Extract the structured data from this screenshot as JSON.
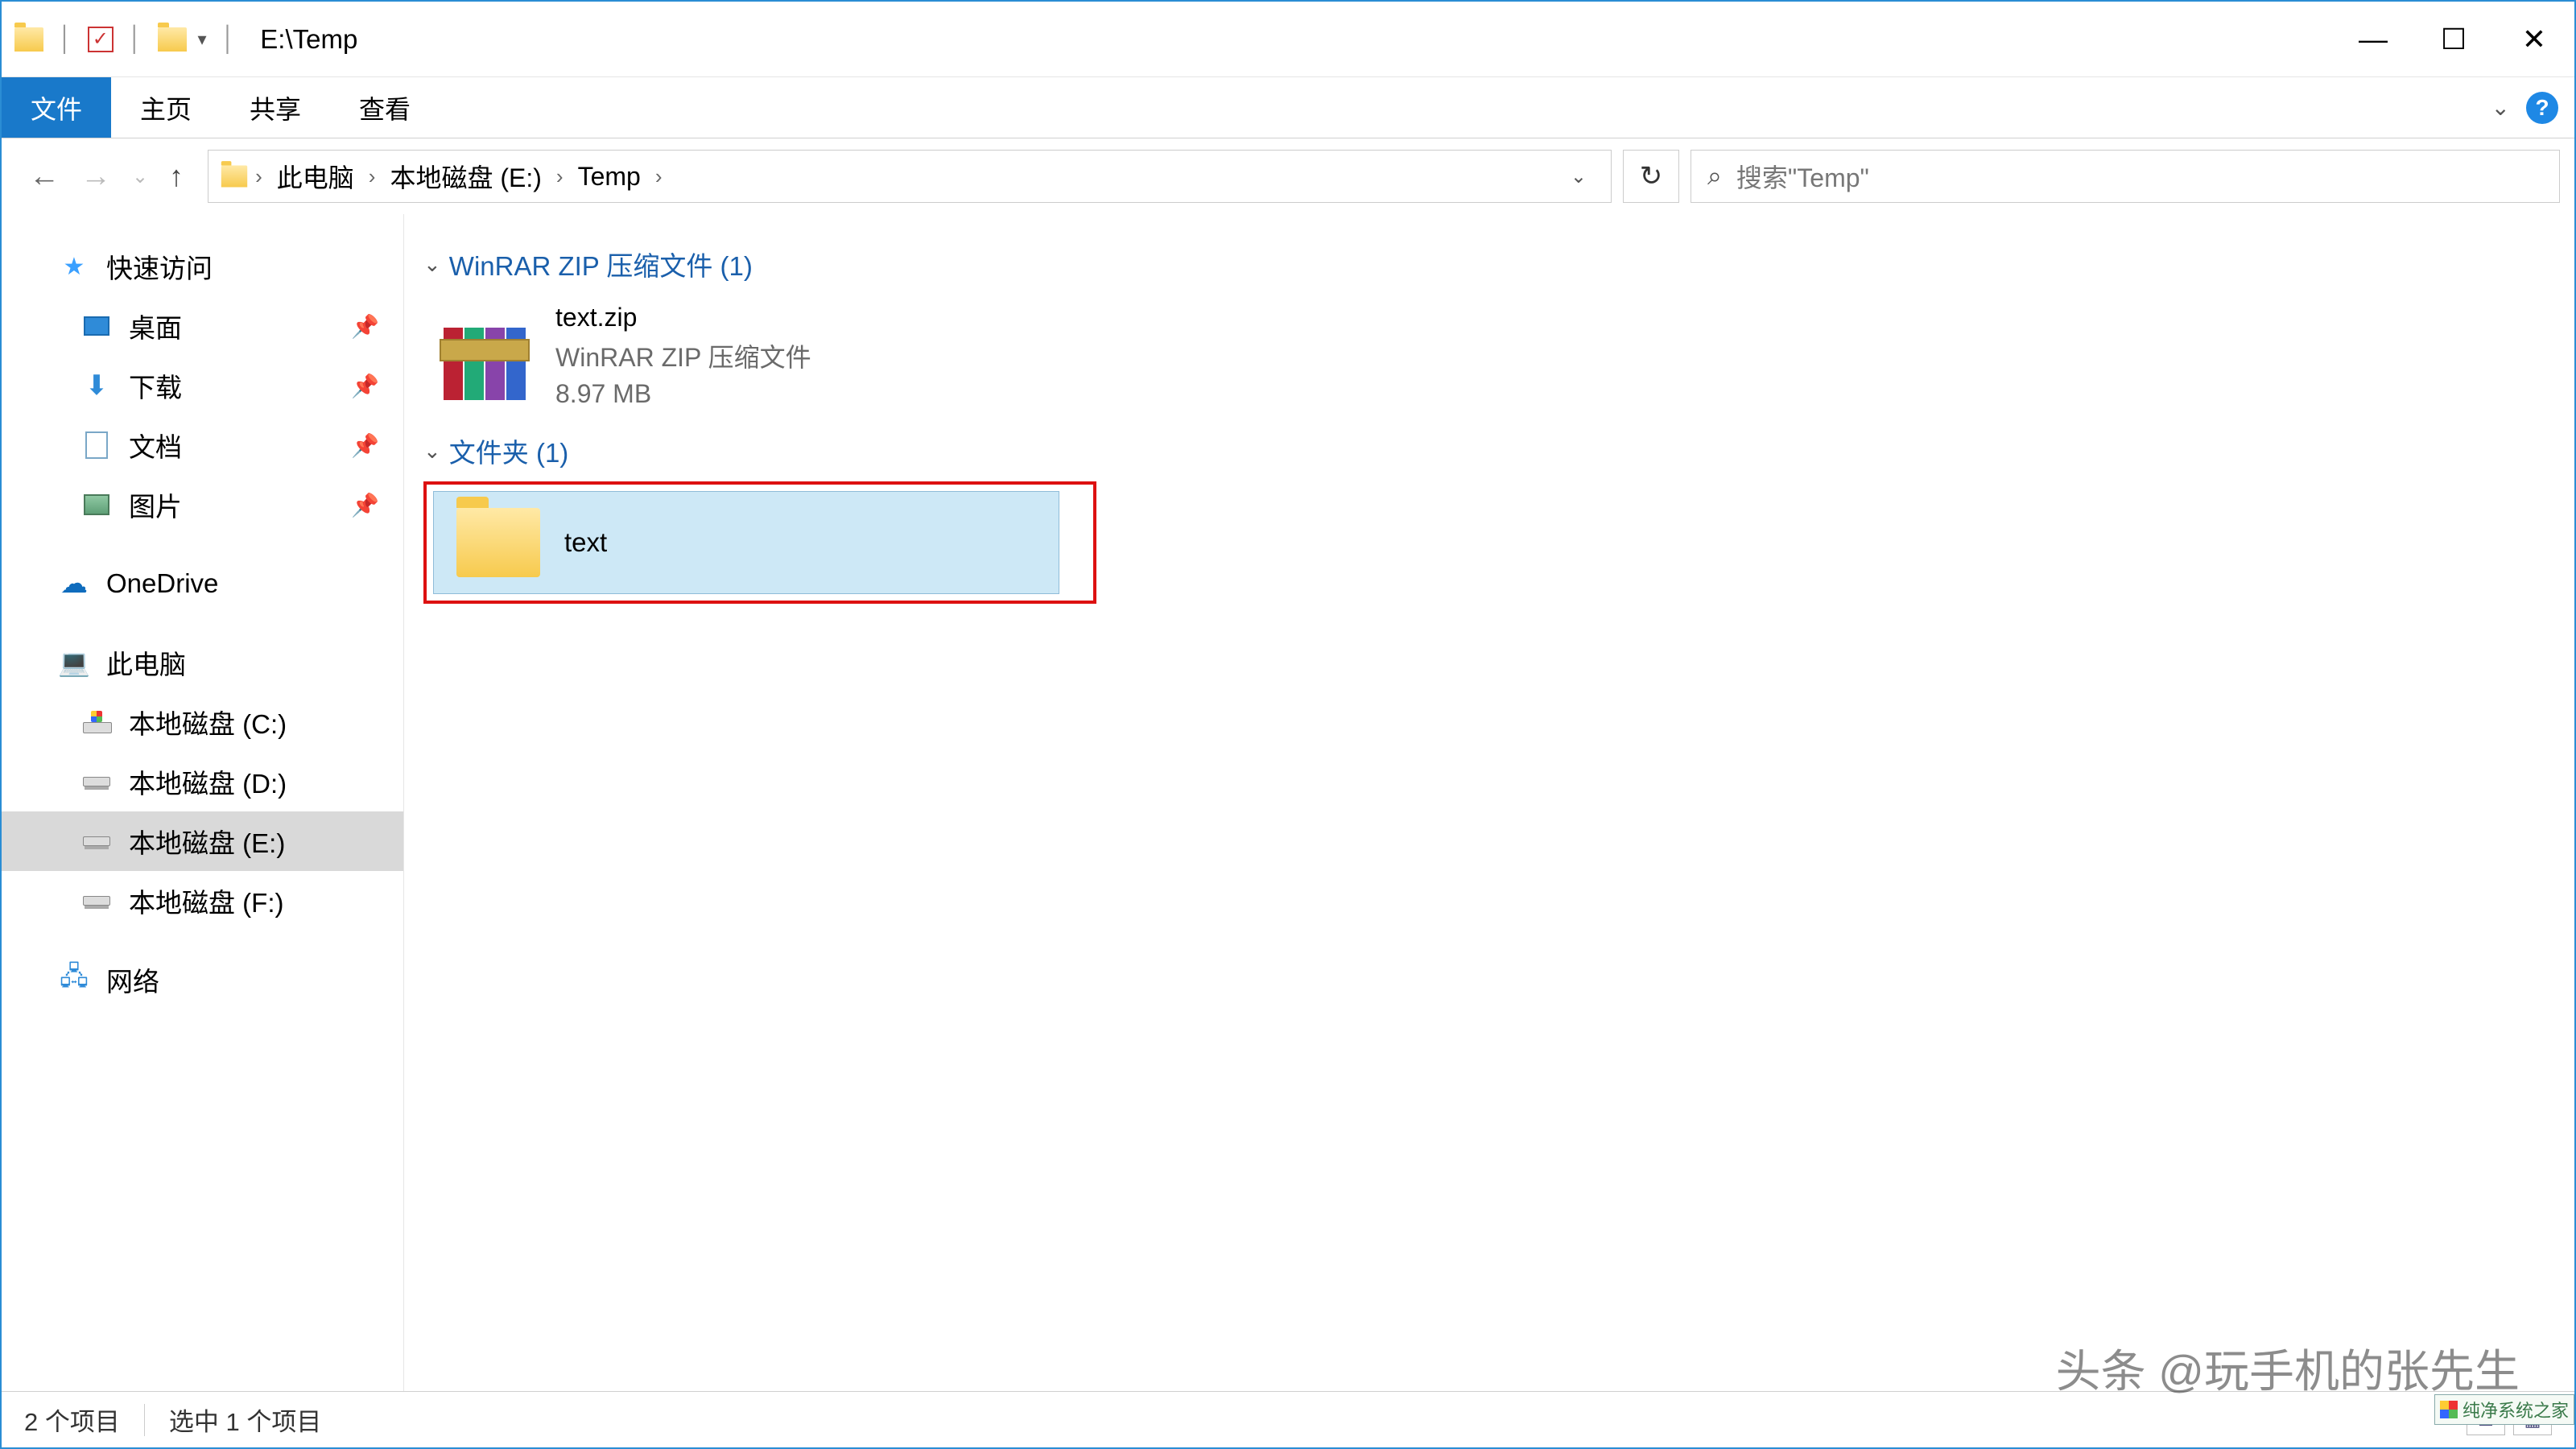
{
  "title": "E:\\Temp",
  "ribbon": {
    "file": "文件",
    "home": "主页",
    "share": "共享",
    "view": "查看"
  },
  "breadcrumb": {
    "this_pc": "此电脑",
    "disk_e": "本地磁盘 (E:)",
    "temp": "Temp"
  },
  "search_placeholder": "搜索\"Temp\"",
  "sidebar": {
    "quick_access": "快速访问",
    "desktop": "桌面",
    "downloads": "下载",
    "documents": "文档",
    "pictures": "图片",
    "onedrive": "OneDrive",
    "this_pc": "此电脑",
    "disk_c": "本地磁盘 (C:)",
    "disk_d": "本地磁盘 (D:)",
    "disk_e": "本地磁盘 (E:)",
    "disk_f": "本地磁盘 (F:)",
    "network": "网络"
  },
  "groups": {
    "zip_header": "WinRAR ZIP 压缩文件 (1)",
    "folder_header": "文件夹 (1)"
  },
  "files": {
    "zip": {
      "name": "text.zip",
      "type": "WinRAR ZIP 压缩文件",
      "size": "8.97 MB"
    },
    "folder": {
      "name": "text"
    }
  },
  "status": {
    "items": "2 个项目",
    "selected": "选中 1 个项目"
  },
  "watermark": "头条 @玩手机的张先生",
  "corner": "纯净系统之家"
}
